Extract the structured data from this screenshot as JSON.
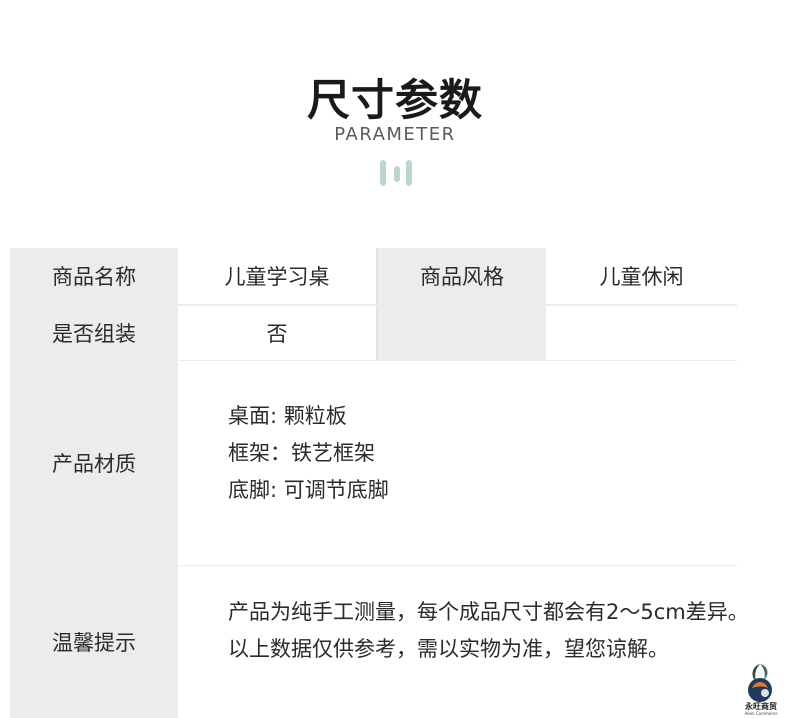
{
  "header": {
    "title": "尺寸参数",
    "subtitle": "PARAMETER"
  },
  "table": {
    "row1": {
      "label1": "商品名称",
      "value1": "儿童学习桌",
      "label2": "商品风格",
      "value2": "儿童休闲"
    },
    "row2": {
      "label": "是否组装",
      "value": "否"
    },
    "materials": {
      "label": "产品材质",
      "lines": [
        "桌面: 颗粒板",
        "框架：铁艺框架",
        "底脚: 可调节底脚"
      ]
    },
    "tips": {
      "label": "温馨提示",
      "lines": [
        "产品为纯手工测量，每个成品尺寸都会有2～5cm差异。",
        "以上数据仅供参考，需以实物为准，望您谅解。"
      ]
    }
  },
  "logo": {
    "text": "永旺商贸",
    "subtext": "Aeon Commerce"
  },
  "colors": {
    "accent_bars": "#bcd5cd",
    "label_bg": "#ececec",
    "value_bg": "#ffffff"
  }
}
